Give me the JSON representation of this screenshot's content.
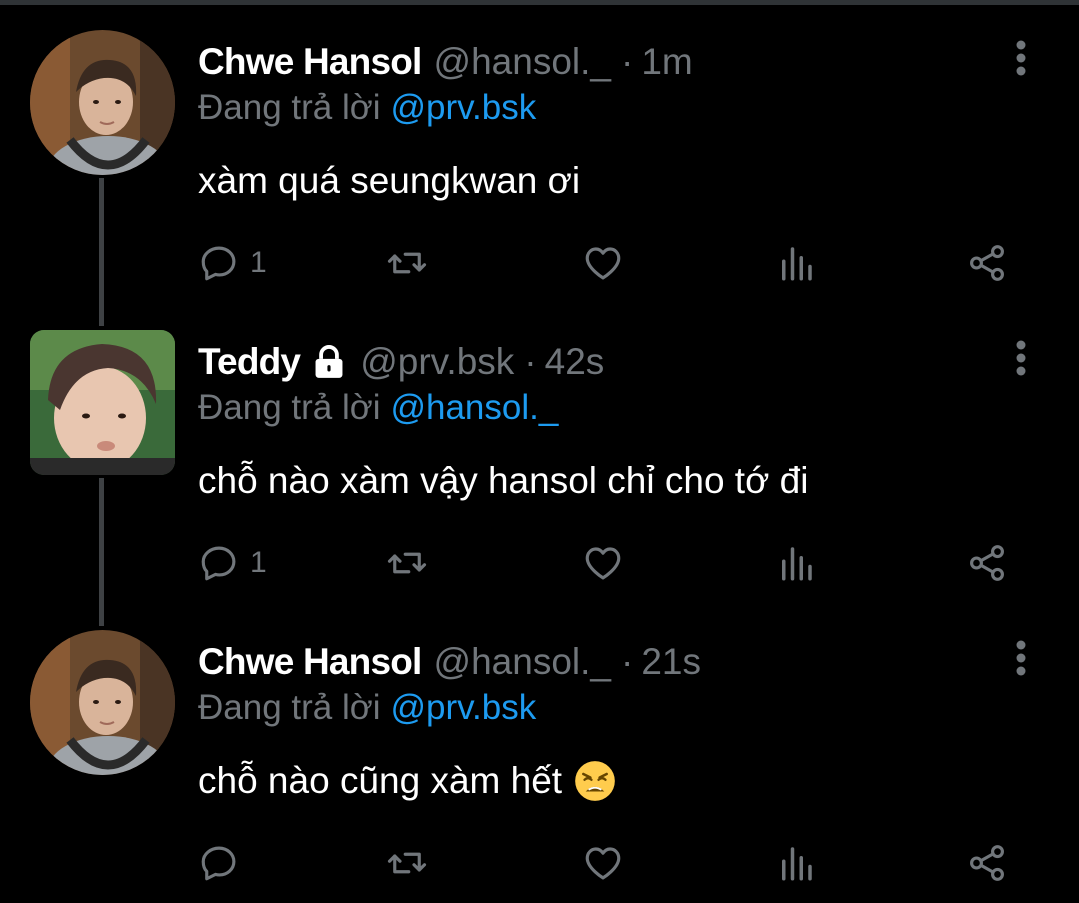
{
  "tweets": [
    {
      "display_name": "Chwe Hansol",
      "handle": "@hansol._",
      "separator": "·",
      "time": "1m",
      "reply_prefix": "Đang trả lời",
      "reply_to": "@prv.bsk",
      "text": "xàm quá seungkwan ơi",
      "reply_count": "1",
      "locked": false,
      "avatar": "avatar-photo"
    },
    {
      "display_name": "Teddy",
      "handle": "@prv.bsk",
      "separator": "·",
      "time": "42s",
      "reply_prefix": "Đang trả lời",
      "reply_to": "@hansol._",
      "text": "chỗ nào xàm vậy hansol chỉ cho tớ đi",
      "reply_count": "1",
      "locked": true,
      "avatar": "avatar-photo"
    },
    {
      "display_name": "Chwe Hansol",
      "handle": "@hansol._",
      "separator": "·",
      "time": "21s",
      "reply_prefix": "Đang trả lời",
      "reply_to": "@prv.bsk",
      "text": "chỗ nào cũng xàm hết",
      "emoji": "weary-face-emoji",
      "reply_count": "",
      "locked": false,
      "avatar": "avatar-photo"
    }
  ],
  "icons": {
    "reply": "reply-icon",
    "retweet": "retweet-icon",
    "like": "heart-icon",
    "views": "views-icon",
    "share": "share-icon",
    "menu": "more-vertical-icon",
    "lock": "lock-icon"
  },
  "colors": {
    "background": "#000000",
    "primary_text": "#ffffff",
    "secondary_text": "#71767b",
    "link": "#1d9bf0",
    "thread_line": "#3e4144"
  }
}
